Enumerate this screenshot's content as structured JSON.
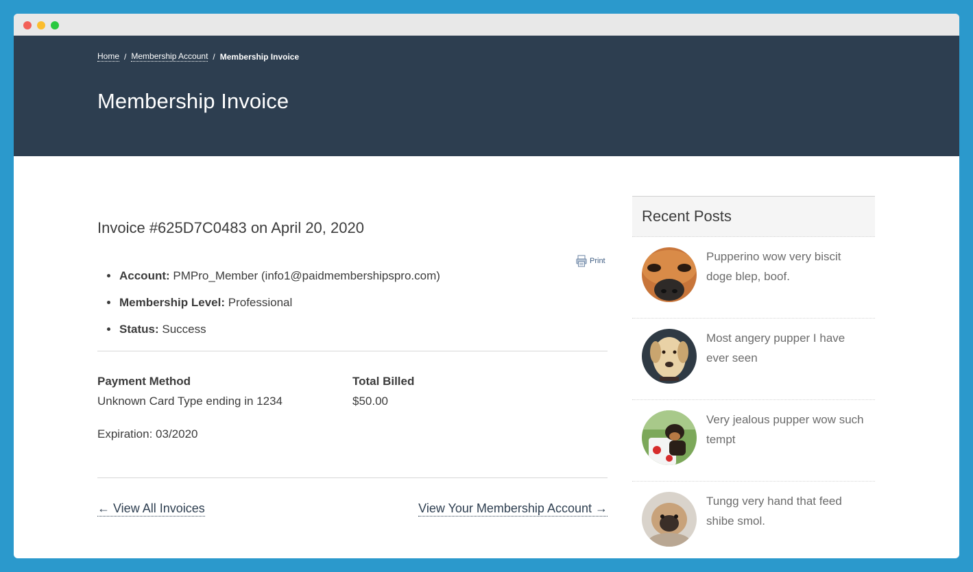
{
  "window": {
    "controls": [
      "close",
      "minimize",
      "maximize"
    ]
  },
  "breadcrumb": {
    "home": "Home",
    "account": "Membership Account",
    "separator": "/",
    "current": "Membership Invoice"
  },
  "page_title": "Membership Invoice",
  "invoice": {
    "title": "Invoice #625D7C0483 on April 20, 2020",
    "print_label": "Print",
    "account_label": "Account:",
    "account_value": "PMPro_Member (info1@paidmembershipspro.com)",
    "level_label": "Membership Level:",
    "level_value": "Professional",
    "status_label": "Status:",
    "status_value": "Success",
    "payment_method_label": "Payment Method",
    "payment_method_value": "Unknown Card Type ending in 1234",
    "total_billed_label": "Total Billed",
    "total_billed_value": "$50.00",
    "expiration": "Expiration: 03/2020"
  },
  "nav": {
    "all_invoices": "← View All Invoices",
    "membership_account": "View Your Membership Account →"
  },
  "sidebar": {
    "title": "Recent Posts",
    "posts": [
      {
        "text": "Pupperino wow very biscit doge blep, boof.",
        "icon": "dog-nose-avatar"
      },
      {
        "text": "Most angery pupper I have ever seen",
        "icon": "labrador-avatar"
      },
      {
        "text": "Very jealous pupper wow such tempt",
        "icon": "puppy-mug-avatar"
      },
      {
        "text": "Tungg very hand that feed shibe smol.",
        "icon": "pug-avatar"
      }
    ]
  },
  "colors": {
    "background": "#2b99cc",
    "hero": "#2d3e50",
    "text": "#3b3b3b",
    "muted": "#6b6b6b"
  }
}
